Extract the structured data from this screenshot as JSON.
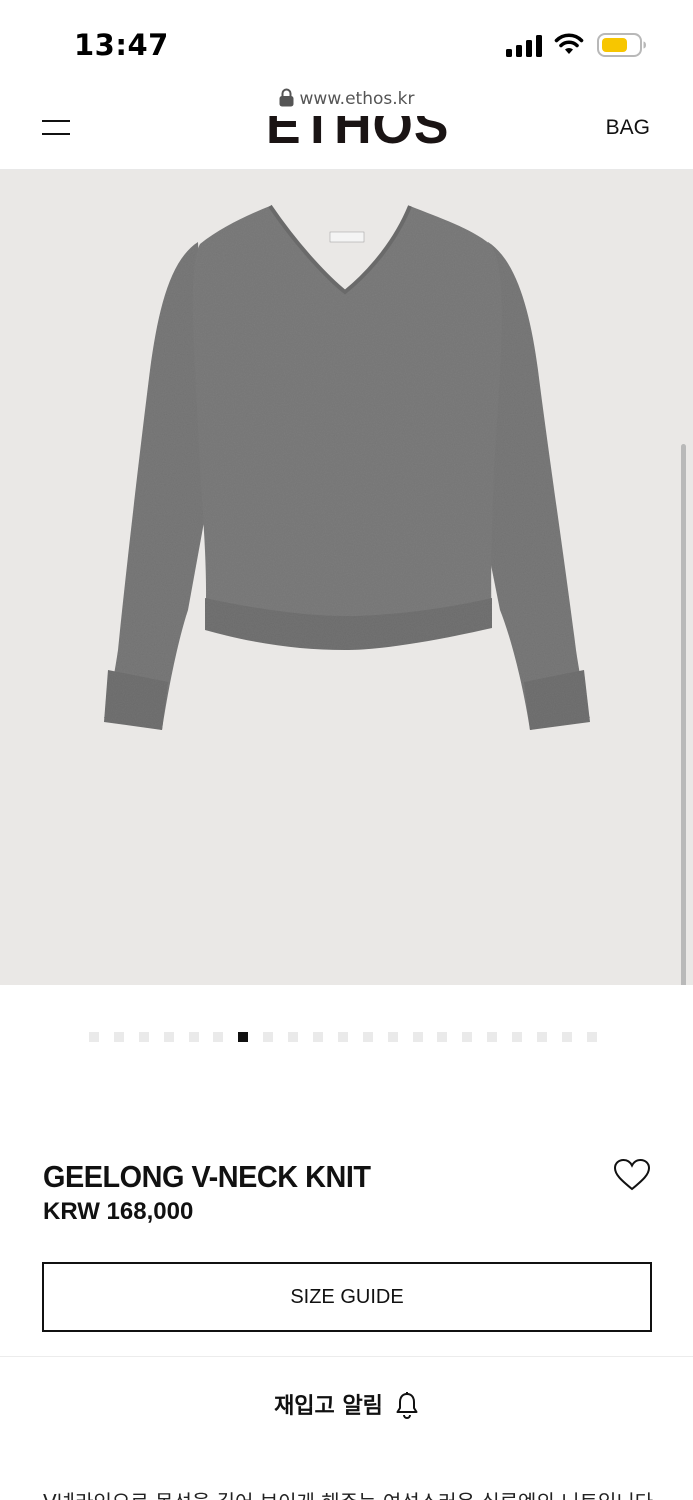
{
  "status_bar": {
    "time": "13:47",
    "signal_icon": "cellular-signal-icon",
    "wifi_icon": "wifi-icon",
    "battery_icon": "battery-icon",
    "battery_color": "#f7c600"
  },
  "browser": {
    "url": "www.ethos.kr",
    "lock_icon": "lock-icon"
  },
  "header": {
    "menu_icon": "hamburger-menu-icon",
    "brand": "ETHOS",
    "bag_label": "BAG"
  },
  "product": {
    "image_icon": "v-neck-sweater-image",
    "image_background": "#eae8e6",
    "gallery": {
      "total": 21,
      "current": 7
    },
    "name": "GEELONG V-NECK KNIT",
    "price": "KRW 168,000",
    "wishlist_icon": "heart-icon",
    "size_guide_label": "SIZE GUIDE",
    "restock_label": "재입고 알림",
    "restock_icon": "bell-icon",
    "description": "V넥라인으로 목선을 길어 보이게 해주는 여성스러운 실루엣의 니트입니다."
  }
}
